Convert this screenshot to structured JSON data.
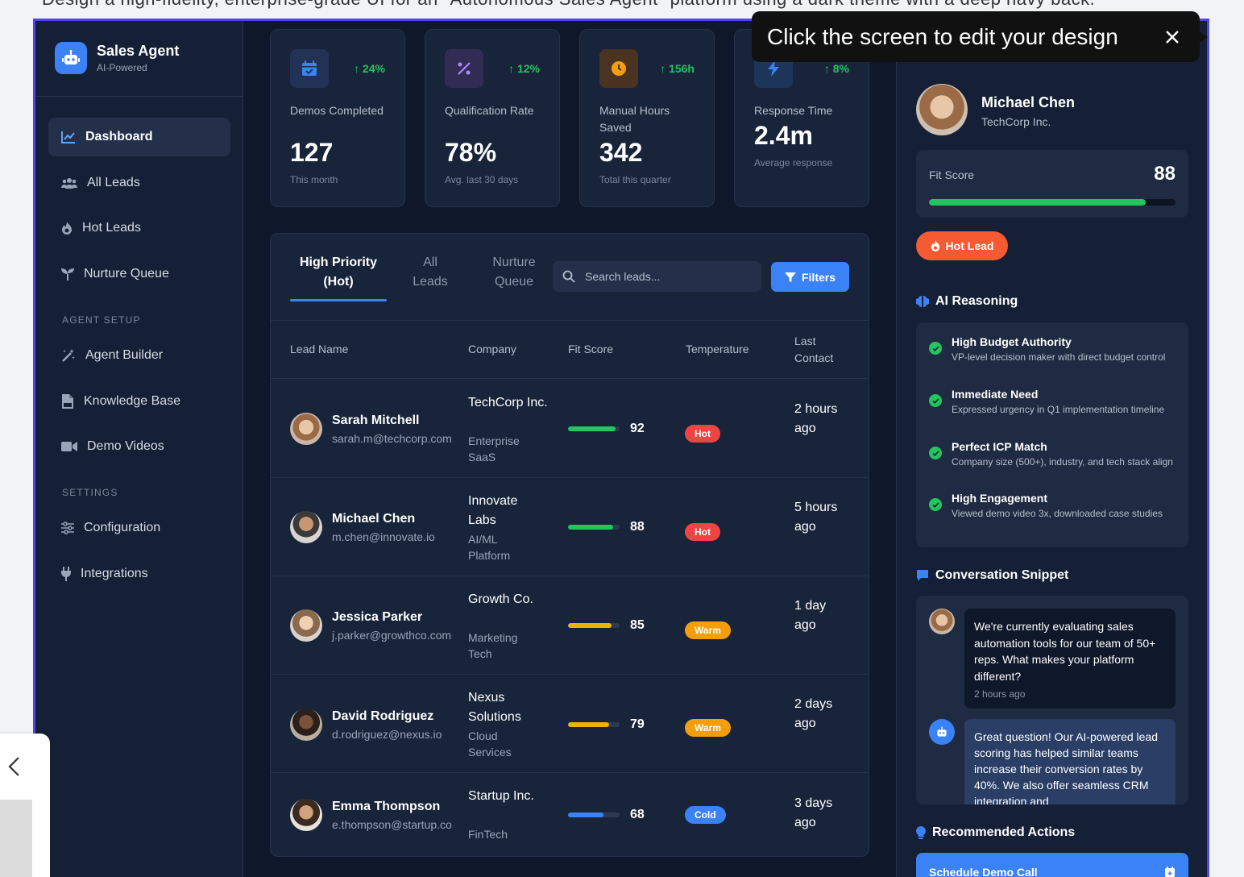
{
  "page_heading": "Design a high-fidelity, enterprise-grade UI for an \"Autonomous Sales Agent\" platform using a dark theme with a deep navy back.",
  "tooltip": {
    "text": "Click the screen to edit your design",
    "close_icon": "close-icon"
  },
  "sidebar": {
    "brand_title": "Sales Agent",
    "brand_sub": "AI-Powered",
    "items": [
      {
        "label": "Dashboard",
        "icon": "chart-line-icon",
        "active": true
      },
      {
        "label": "All Leads",
        "icon": "users-icon"
      },
      {
        "label": "Hot Leads",
        "icon": "fire-icon"
      },
      {
        "label": "Nurture Queue",
        "icon": "seedling-icon"
      }
    ],
    "section_agent": "AGENT SETUP",
    "agent_items": [
      {
        "label": "Agent Builder",
        "icon": "magic-wand-icon"
      },
      {
        "label": "Knowledge Base",
        "icon": "pdf-file-icon"
      },
      {
        "label": "Demo Videos",
        "icon": "video-icon"
      }
    ],
    "section_settings": "SETTINGS",
    "settings_items": [
      {
        "label": "Configuration",
        "icon": "sliders-icon"
      },
      {
        "label": "Integrations",
        "icon": "plug-icon"
      }
    ]
  },
  "stats": [
    {
      "change": "24%",
      "label": "Demos Completed",
      "value": "127",
      "note": "This month",
      "icon": "calendar-check-icon",
      "color": "#3b82f6"
    },
    {
      "change": "12%",
      "label": "Qualification Rate",
      "value": "78%",
      "note": "Avg. last 30 days",
      "icon": "percent-icon",
      "color": "#a78bfa"
    },
    {
      "change": "156h",
      "label": "Manual Hours Saved",
      "value": "342",
      "note": "Total this quarter",
      "icon": "clock-icon",
      "color": "#f59e0b"
    },
    {
      "change": "8%",
      "label": "Response Time",
      "value": "2.4m",
      "note": "Average response",
      "icon": "bolt-icon",
      "color": "#3b82f6"
    }
  ],
  "table": {
    "tabs": [
      "High Priority (Hot)",
      "All Leads",
      "Nurture Queue"
    ],
    "search_placeholder": "Search leads...",
    "filters_label": "Filters",
    "headers": [
      "Lead Name",
      "Company",
      "Fit Score",
      "Temperature",
      "Last Contact"
    ],
    "rows": [
      {
        "name": "Sarah Mitchell",
        "email": "sarah.m@techcorp.com",
        "company": "TechCorp Inc.",
        "industry": "Enterprise SaaS",
        "score": 92,
        "temp": "Hot",
        "last": "2 hours ago"
      },
      {
        "name": "Michael Chen",
        "email": "m.chen@innovate.io",
        "company": "Innovate Labs",
        "industry": "AI/ML Platform",
        "score": 88,
        "temp": "Hot",
        "last": "5 hours ago"
      },
      {
        "name": "Jessica Parker",
        "email": "j.parker@growthco.com",
        "company": "Growth Co.",
        "industry": "Marketing Tech",
        "score": 85,
        "temp": "Warm",
        "last": "1 day ago"
      },
      {
        "name": "David Rodriguez",
        "email": "d.rodriguez@nexus.io",
        "company": "Nexus Solutions",
        "industry": "Cloud Services",
        "score": 79,
        "temp": "Warm",
        "last": "2 days ago"
      },
      {
        "name": "Emma Thompson",
        "email": "e.thompson@startup.co",
        "company": "Startup Inc.",
        "industry": "FinTech",
        "score": 68,
        "temp": "Cold",
        "last": "3 days ago"
      }
    ]
  },
  "temp_colors": {
    "Hot": "#ef4444",
    "Warm": "#f59e0b",
    "Cold": "#3b82f6"
  },
  "score_colors": {
    "high": "#22c55e",
    "mid": "#eab308",
    "low": "#3b82f6"
  },
  "detail": {
    "name": "Michael Chen",
    "company": "TechCorp Inc.",
    "fit_label": "Fit Score",
    "fit_score": 88,
    "badge": "Hot Lead",
    "ai_title": "AI Reasoning",
    "reasons": [
      {
        "title": "High Budget Authority",
        "desc": "VP-level decision maker with direct budget control"
      },
      {
        "title": "Immediate Need",
        "desc": "Expressed urgency in Q1 implementation timeline"
      },
      {
        "title": "Perfect ICP Match",
        "desc": "Company size (500+), industry, and tech stack align"
      },
      {
        "title": "High Engagement",
        "desc": "Viewed demo video 3x, downloaded case studies"
      }
    ],
    "conv_title": "Conversation Snippet",
    "msg_lead": "We're currently evaluating sales automation tools for our team of 50+ reps. What makes your platform different?",
    "msg_lead_time": "2 hours ago",
    "msg_agent": "Great question! Our AI-powered lead scoring has helped similar teams increase their conversion rates by 40%. We also offer seamless CRM integration and",
    "actions_title": "Recommended Actions",
    "action_primary": "Schedule Demo Call"
  }
}
